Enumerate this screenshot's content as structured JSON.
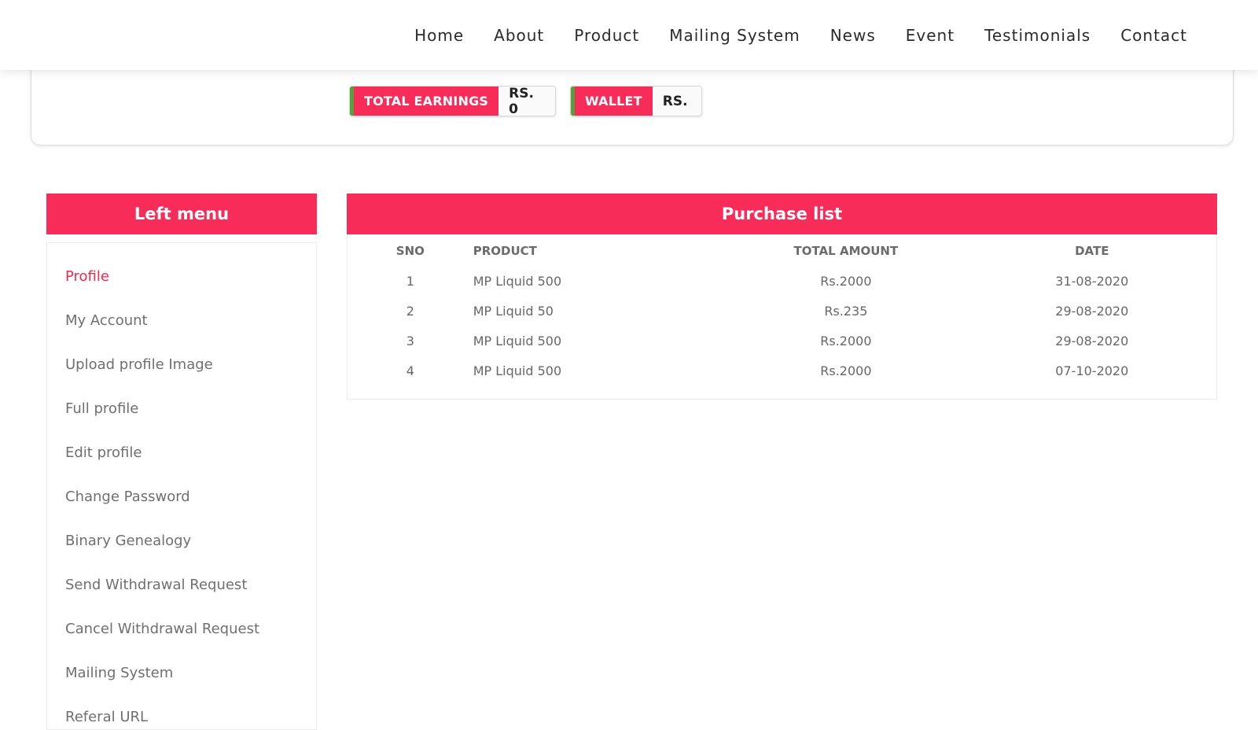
{
  "nav": {
    "items": [
      "Home",
      "About",
      "Product",
      "Mailing System",
      "News",
      "Event",
      "Testimonials",
      "Contact"
    ]
  },
  "summary": {
    "earnings_label": "TOTAL EARNINGS",
    "earnings_value": "RS. 0",
    "wallet_label": "WALLET",
    "wallet_value": "RS."
  },
  "left_menu": {
    "title": "Left menu",
    "items": [
      "Profile",
      "My Account",
      "Upload profile Image",
      "Full profile",
      "Edit profile",
      "Change Password",
      "Binary Genealogy",
      "Send Withdrawal Request",
      "Cancel Withdrawal Request",
      "Mailing System",
      "Referal URL"
    ],
    "active_index": 0
  },
  "purchase": {
    "title": "Purchase list",
    "columns": [
      "SNO",
      "PRODUCT",
      "TOTAL AMOUNT",
      "DATE"
    ],
    "rows": [
      [
        "1",
        "MP Liquid 500",
        "Rs.2000",
        "31-08-2020"
      ],
      [
        "2",
        "MP Liquid 50",
        "Rs.235",
        "29-08-2020"
      ],
      [
        "3",
        "MP Liquid 500",
        "Rs.2000",
        "29-08-2020"
      ],
      [
        "4",
        "MP Liquid 500",
        "Rs.2000",
        "07-10-2020"
      ]
    ]
  },
  "colors": {
    "accent": "#f72c58",
    "badge_stripe": "#57a03a",
    "active_link": "#f0284e"
  }
}
